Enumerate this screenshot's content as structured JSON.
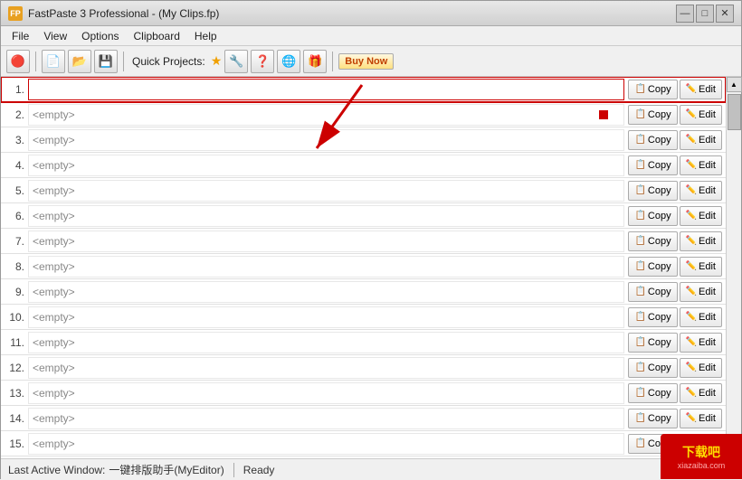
{
  "titleBar": {
    "title": "FastPaste 3 Professional  -  (My Clips.fp)",
    "minBtn": "—",
    "maxBtn": "□",
    "closeBtn": "✕"
  },
  "menuBar": {
    "items": [
      "File",
      "View",
      "Options",
      "Clipboard",
      "Help"
    ]
  },
  "toolbar": {
    "quickProjectsLabel": "Quick Projects:",
    "buyNowLabel": "Buy Now"
  },
  "rows": [
    {
      "num": "1.",
      "value": "",
      "isEmpty": false,
      "isSelected": true
    },
    {
      "num": "2.",
      "value": "<empty>",
      "isEmpty": true,
      "isSelected": false
    },
    {
      "num": "3.",
      "value": "<empty>",
      "isEmpty": true,
      "isSelected": false
    },
    {
      "num": "4.",
      "value": "<empty>",
      "isEmpty": true,
      "isSelected": false
    },
    {
      "num": "5.",
      "value": "<empty>",
      "isEmpty": true,
      "isSelected": false
    },
    {
      "num": "6.",
      "value": "<empty>",
      "isEmpty": true,
      "isSelected": false
    },
    {
      "num": "7.",
      "value": "<empty>",
      "isEmpty": true,
      "isSelected": false
    },
    {
      "num": "8.",
      "value": "<empty>",
      "isEmpty": true,
      "isSelected": false
    },
    {
      "num": "9.",
      "value": "<empty>",
      "isEmpty": true,
      "isSelected": false
    },
    {
      "num": "10.",
      "value": "<empty>",
      "isEmpty": true,
      "isSelected": false
    },
    {
      "num": "11.",
      "value": "<empty>",
      "isEmpty": true,
      "isSelected": false
    },
    {
      "num": "12.",
      "value": "<empty>",
      "isEmpty": true,
      "isSelected": false
    },
    {
      "num": "13.",
      "value": "<empty>",
      "isEmpty": true,
      "isSelected": false
    },
    {
      "num": "14.",
      "value": "<empty>",
      "isEmpty": true,
      "isSelected": false
    },
    {
      "num": "15.",
      "value": "<empty>",
      "isEmpty": true,
      "isSelected": false
    }
  ],
  "buttons": {
    "copyLabel": "Copy",
    "editLabel": "Edit"
  },
  "statusBar": {
    "activeWindowLabel": "Last Active Window:",
    "activeWindowValue": "一键排版助手(MyEditor)",
    "status": "Ready"
  },
  "watermark": {
    "line1": "下载吧",
    "line2": "xiazaiba.com"
  }
}
